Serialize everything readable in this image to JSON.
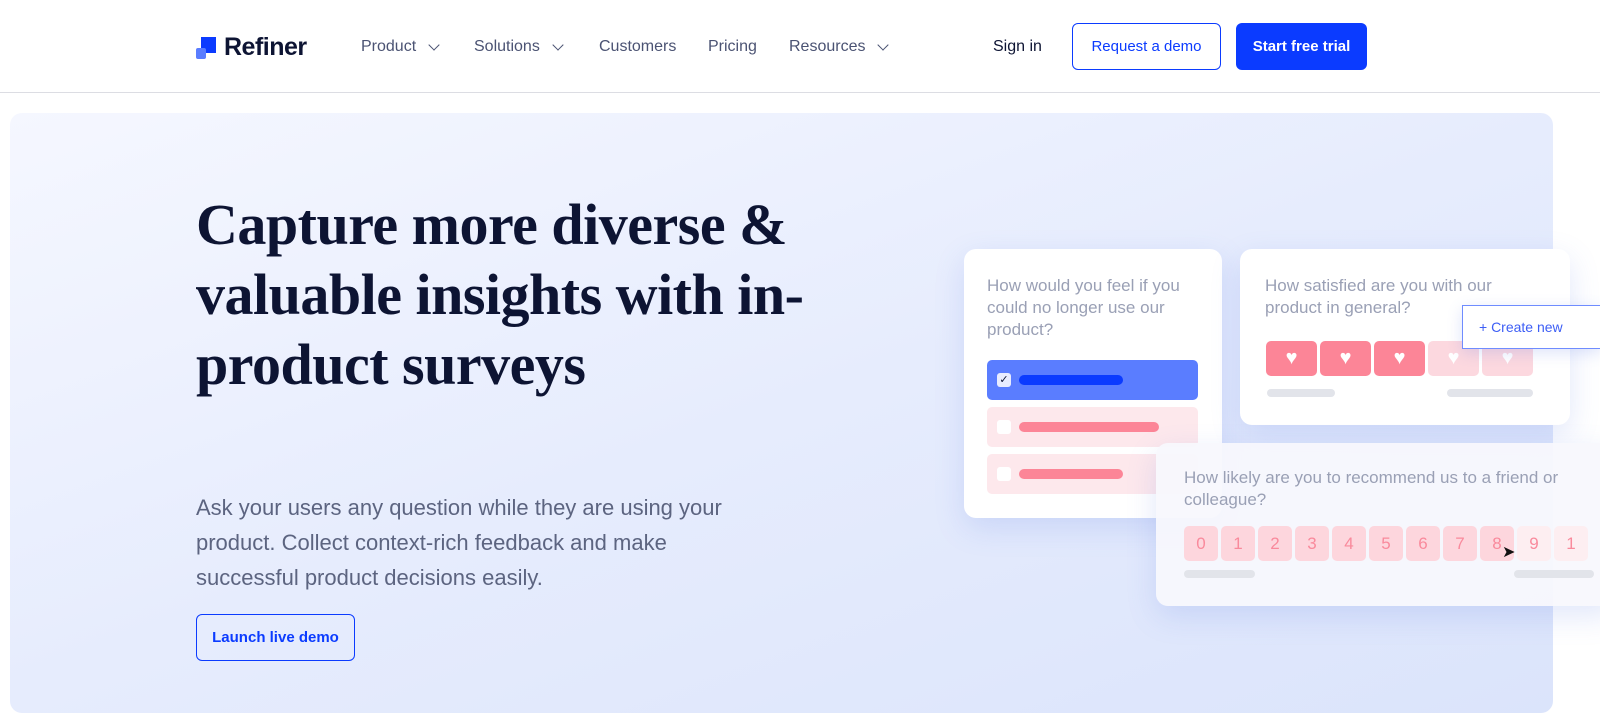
{
  "nav": {
    "brand": "Refiner",
    "items": [
      {
        "label": "Product",
        "dropdown": true
      },
      {
        "label": "Solutions",
        "dropdown": true
      },
      {
        "label": "Customers",
        "dropdown": false
      },
      {
        "label": "Pricing",
        "dropdown": false
      },
      {
        "label": "Resources",
        "dropdown": true
      }
    ],
    "sign_in": "Sign in",
    "request_demo": "Request a demo",
    "start_trial": "Start free trial"
  },
  "hero": {
    "title": "Capture more diverse & valuable insights with in-product surveys",
    "subtitle": "Ask your users any question while they are using your product. Collect context-rich feedback and make successful product decisions easily.",
    "cta": "Launch live demo"
  },
  "cards": {
    "pmf": {
      "question": "How would you feel if you could no longer use our product?"
    },
    "csat": {
      "question": "How satisfied are you with our product in general?",
      "rating": 3,
      "max": 5,
      "create_new": "+ Create new"
    },
    "nps": {
      "question": "How likely are you to recommend us to a friend or colleague?",
      "scale": [
        "0",
        "1",
        "2",
        "3",
        "4",
        "5",
        "6",
        "7",
        "8",
        "9",
        "1"
      ]
    }
  },
  "colors": {
    "brand": "#0b3bff",
    "accent_pink": "#fc8597",
    "heading": "#0d1433"
  }
}
